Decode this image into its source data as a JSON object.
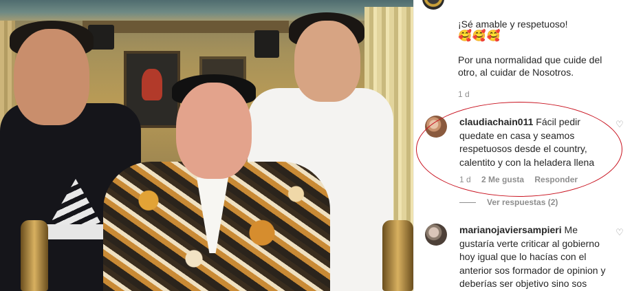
{
  "post": {
    "caption_line1": "¡Sé amable y respetuoso!",
    "caption_emoji": "🥰🥰🥰",
    "caption_line2": "Por una normalidad que cuide del otro, al cuidar de Nosotros.",
    "caption_time": "1 d"
  },
  "comments": [
    {
      "username": "claudiachain011",
      "text": "Fácil pedir quedate en casa y seamos respetuosos desde el country, calentito y con la heladera llena",
      "time": "1 d",
      "likes": "2 Me gusta",
      "reply_label": "Responder",
      "view_replies": "Ver respuestas (2)",
      "like_icon": "heart-outline-icon"
    },
    {
      "username": "marianojaviersampieri",
      "text": "Me gustaría verte criticar al gobierno hoy igual que lo hacías con el anterior sos formador de opinion y deberías ser objetivo sino sos",
      "like_icon": "heart-outline-icon"
    }
  ],
  "annotation": {
    "color": "#c8101d",
    "shape": "oval"
  }
}
